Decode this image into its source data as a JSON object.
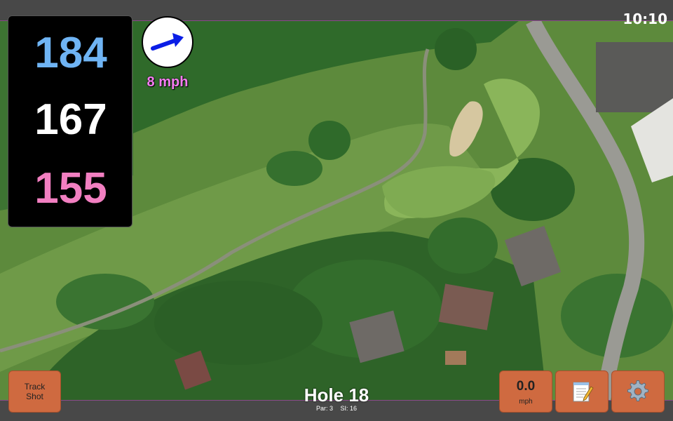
{
  "status": {
    "time": "10:10"
  },
  "distances": {
    "back": "184",
    "center": "167",
    "front": "155"
  },
  "wind": {
    "speed": "8 mph",
    "icon": "arrow-icon",
    "color": "#f57df1"
  },
  "hole": {
    "title": "Hole 18",
    "par": "Par: 3",
    "stroke_index": "SI: 16"
  },
  "buttons": {
    "track_shot": "Track\nShot",
    "speed_value": "0.0",
    "speed_unit": "mph",
    "notes_icon": "notepad-icon",
    "settings_icon": "gear-icon"
  },
  "colors": {
    "back_distance": "#6fb4f4",
    "center_distance": "#ffffff",
    "front_distance": "#f27fc1",
    "button": "#cf6a40"
  }
}
